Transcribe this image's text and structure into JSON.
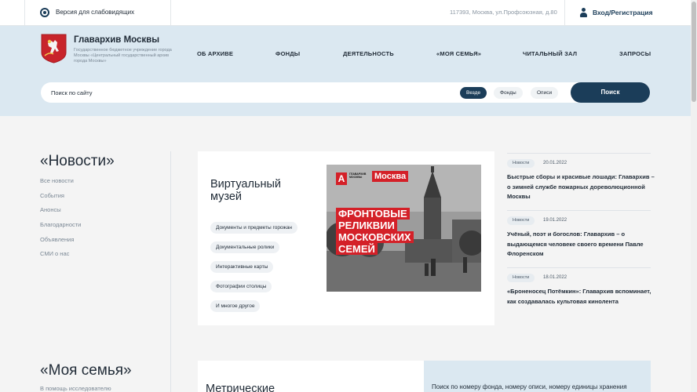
{
  "topbar": {
    "vision_label": "Версия для слабовидящих",
    "address": "117393, Москва, ул.Профсоюзная, д.80",
    "login_label": "Вход/Регистрация"
  },
  "header": {
    "brand": "Главархив Москвы",
    "subbrand": "Государственное бюджетное учреждение города Москвы «Центральный государственный архив города Москвы»",
    "nav": [
      "ОБ АРХИВЕ",
      "ФОНДЫ",
      "ДЕЯТЕЛЬНОСТЬ",
      "«МОЯ СЕМЬЯ»",
      "ЧИТАЛЬНЫЙ ЗАЛ",
      "ЗАПРОСЫ"
    ]
  },
  "search": {
    "placeholder": "Поиск по сайту",
    "chips": [
      "Везде",
      "Фонды",
      "Описи"
    ],
    "button": "Поиск"
  },
  "news_section": {
    "title": "«Новости»",
    "links": [
      "Все новости",
      "События",
      "Анонсы",
      "Благодарности",
      "Объявления",
      "СМИ о нас"
    ]
  },
  "museum_card": {
    "title": "Виртуальный музей",
    "tags": [
      "Документы и предметы горожан",
      "Документальные ролики",
      "Интерактивные карты",
      "Фотографии столицы",
      "И многое другое"
    ],
    "poster": {
      "logo_small": "ГЛАВАРХИВ МОСКВЫ",
      "logo_word": "Москва",
      "lines": [
        "ФРОНТОВЫЕ",
        "РЕЛИКВИИ",
        "МОСКОВСКИХ",
        "СЕМЕЙ"
      ]
    }
  },
  "news": [
    {
      "badge": "Новости",
      "date": "20.01.2022",
      "title": "Быстрые сборы и красивые лошади: Главархив – о зимней службе пожарных дореволюционной Москвы"
    },
    {
      "badge": "Новости",
      "date": "19.01.2022",
      "title": "Учёный, поэт и богослов: Главархив – о выдающемся человеке своего времени Павле Флоренском"
    },
    {
      "badge": "Новости",
      "date": "18.01.2022",
      "title": "«Броненосец Потёмкин»: Главархив вспоминает, как создавалась культовая кинолента"
    }
  ],
  "family_section": {
    "title": "«Моя семья»",
    "links": [
      "В помощь исследователю"
    ]
  },
  "metrics_card": {
    "title": "Метрические"
  },
  "search_hint": {
    "text": "Поиск по номеру фонда, номеру описи, номеру единицы хранения"
  },
  "colors": {
    "navy": "#1b3d59",
    "header_bg": "#dbe8f1",
    "page_bg": "#f4f4f4"
  }
}
